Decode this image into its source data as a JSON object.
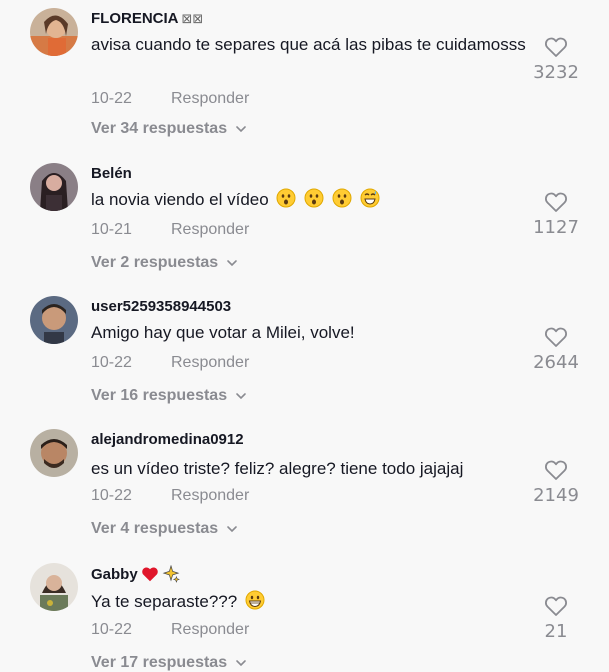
{
  "reply_label": "Responder",
  "comments": [
    {
      "username": "FLORENCIA",
      "username_suffix": "⊠⊠",
      "text": "avisa cuando te separes que acá las pibas te cuidamosss",
      "date": "10-22",
      "likes": "3232",
      "view_replies": "Ver 34 respuestas"
    },
    {
      "username": "Belén",
      "text": "la novia viendo el vídeo",
      "emojis": [
        "astonished-face",
        "astonished-face",
        "astonished-face",
        "grinning-sweat-face"
      ],
      "date": "10-21",
      "likes": "1127",
      "view_replies": "Ver 2 respuestas"
    },
    {
      "username": "user5259358944503",
      "text": "Amigo hay que votar a Milei, volve!",
      "date": "10-22",
      "likes": "2644",
      "view_replies": "Ver 16 respuestas"
    },
    {
      "username": "alejandromedina0912",
      "text": "es un vídeo triste? feliz? alegre? tiene todo jajajaj",
      "date": "10-22",
      "likes": "2149",
      "view_replies": "Ver 4 respuestas"
    },
    {
      "username": "Gabby",
      "username_emojis": [
        "red-heart",
        "sparkles"
      ],
      "text": "Ya te separaste???",
      "emojis": [
        "grinning-face"
      ],
      "date": "10-22",
      "likes": "21",
      "view_replies": "Ver 17 respuestas"
    }
  ],
  "colors": {
    "background": "#f8f8f8",
    "primary_text": "#161823",
    "secondary_text": "#8a8b91",
    "heart_outline": "#8a8b91"
  }
}
